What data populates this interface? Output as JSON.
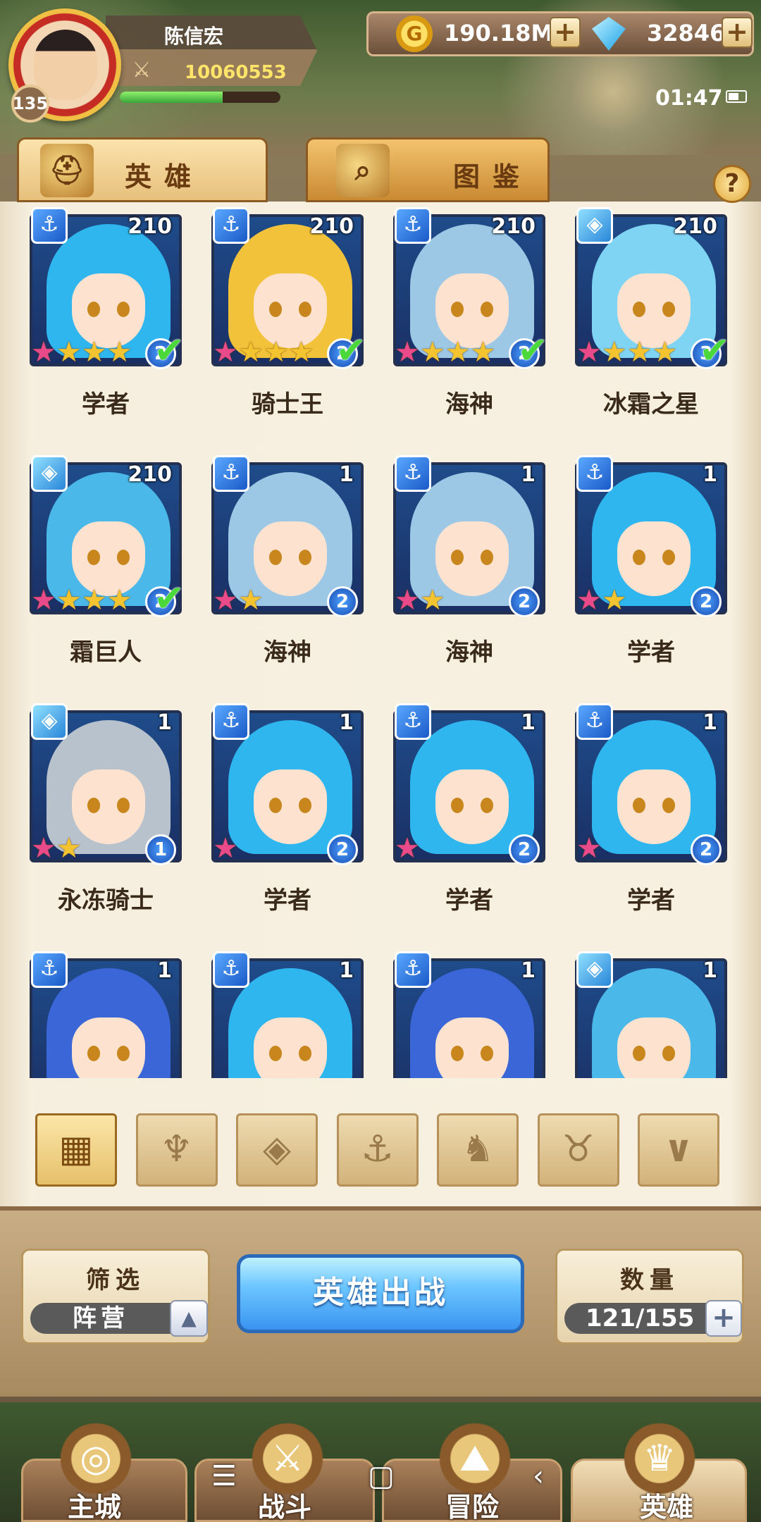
{
  "player": {
    "name": "陈信宏",
    "level": "135",
    "power": "10060553",
    "exp_fraction": 0.64
  },
  "currency": {
    "coins": "190.18M",
    "gems": "32846"
  },
  "status": {
    "time": "01:47"
  },
  "tabs": [
    {
      "label": "英雄",
      "icon": "hero-helmet-icon",
      "active": true
    },
    {
      "label": "图鉴",
      "icon": "magnifier-book-icon",
      "active": false
    }
  ],
  "heroes": [
    {
      "name": "学者",
      "level": "210",
      "faction": "anchor",
      "stars": 4,
      "rank": "2",
      "deployed": true,
      "hair": "#2fb6ee"
    },
    {
      "name": "骑士王",
      "level": "210",
      "faction": "anchor",
      "stars": 4,
      "rank": "2",
      "deployed": true,
      "hair": "#f2c23a"
    },
    {
      "name": "海神",
      "level": "210",
      "faction": "anchor",
      "stars": 4,
      "rank": "2",
      "deployed": true,
      "hair": "#9cc8e6"
    },
    {
      "name": "冰霜之星",
      "level": "210",
      "faction": "ice",
      "stars": 4,
      "rank": "3",
      "deployed": true,
      "hair": "#7fd4f4"
    },
    {
      "name": "霜巨人",
      "level": "210",
      "faction": "ice",
      "stars": 4,
      "rank": "2",
      "deployed": true,
      "hair": "#4ab8e8"
    },
    {
      "name": "海神",
      "level": "1",
      "faction": "anchor",
      "stars": 2,
      "rank": "2",
      "deployed": false,
      "hair": "#9cc8e6"
    },
    {
      "name": "海神",
      "level": "1",
      "faction": "anchor",
      "stars": 2,
      "rank": "2",
      "deployed": false,
      "hair": "#9cc8e6"
    },
    {
      "name": "学者",
      "level": "1",
      "faction": "anchor",
      "stars": 2,
      "rank": "2",
      "deployed": false,
      "hair": "#2fb6ee"
    },
    {
      "name": "永冻骑士",
      "level": "1",
      "faction": "ice",
      "stars": 2,
      "rank": "1",
      "deployed": false,
      "hair": "#b8c2cc"
    },
    {
      "name": "学者",
      "level": "1",
      "faction": "anchor",
      "stars": 1,
      "rank": "2",
      "deployed": false,
      "hair": "#2fb6ee"
    },
    {
      "name": "学者",
      "level": "1",
      "faction": "anchor",
      "stars": 1,
      "rank": "2",
      "deployed": false,
      "hair": "#2fb6ee"
    },
    {
      "name": "学者",
      "level": "1",
      "faction": "anchor",
      "stars": 1,
      "rank": "2",
      "deployed": false,
      "hair": "#2fb6ee"
    },
    {
      "name": "",
      "level": "1",
      "faction": "anchor",
      "stars": 0,
      "rank": "",
      "deployed": false,
      "hair": "#3a66d8"
    },
    {
      "name": "",
      "level": "1",
      "faction": "anchor",
      "stars": 0,
      "rank": "",
      "deployed": false,
      "hair": "#2fb6ee"
    },
    {
      "name": "",
      "level": "1",
      "faction": "anchor",
      "stars": 0,
      "rank": "",
      "deployed": false,
      "hair": "#3a66d8"
    },
    {
      "name": "",
      "level": "1",
      "faction": "ice",
      "stars": 0,
      "rank": "",
      "deployed": false,
      "hair": "#4ab8e8"
    }
  ],
  "filters": [
    {
      "name": "all",
      "icon": "grid-icon",
      "active": true
    },
    {
      "name": "nature",
      "icon": "leaf-crown-icon",
      "active": false
    },
    {
      "name": "ice",
      "icon": "ice-crystal-icon",
      "active": false
    },
    {
      "name": "sea",
      "icon": "anchor-icon",
      "active": false
    },
    {
      "name": "beast",
      "icon": "beast-head-icon",
      "active": false
    },
    {
      "name": "dark",
      "icon": "horned-mask-icon",
      "active": false
    },
    {
      "name": "wing",
      "icon": "v-wing-icon",
      "active": false
    }
  ],
  "controls": {
    "filter_label": "筛选",
    "filter_value": "阵营",
    "deploy_label": "英雄出战",
    "count_label": "数量",
    "count_value": "121/155"
  },
  "nav": [
    {
      "label": "主城",
      "icon": "castle-emblem-icon",
      "active": false
    },
    {
      "label": "战斗",
      "icon": "crossed-swords-icon",
      "active": false
    },
    {
      "label": "冒险",
      "icon": "map-scroll-icon",
      "active": false
    },
    {
      "label": "英雄",
      "icon": "hero-crest-icon",
      "active": true
    }
  ]
}
